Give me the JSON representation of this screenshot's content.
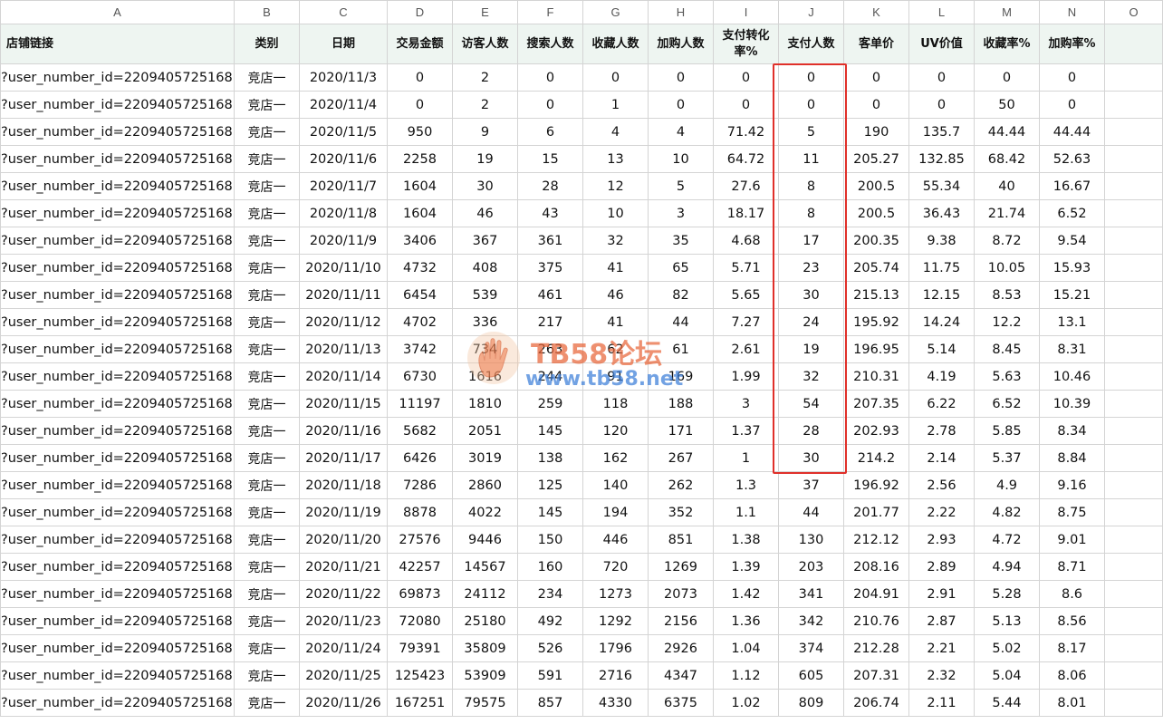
{
  "columns": [
    "A",
    "B",
    "C",
    "D",
    "E",
    "F",
    "G",
    "H",
    "I",
    "J",
    "K",
    "L",
    "M",
    "N",
    "O"
  ],
  "headers": [
    "店铺链接",
    "类别",
    "日期",
    "交易金额",
    "访客人数",
    "搜索人数",
    "收藏人数",
    "加购人数",
    "支付转化率%",
    "支付人数",
    "客单价",
    "UV价值",
    "收藏率%",
    "加购率%",
    ""
  ],
  "rows": [
    [
      "?user_number_id=2209405725168",
      "竞店一",
      "2020/11/3",
      "0",
      "2",
      "0",
      "0",
      "0",
      "0",
      "0",
      "0",
      "0",
      "0",
      "0"
    ],
    [
      "?user_number_id=2209405725168",
      "竞店一",
      "2020/11/4",
      "0",
      "2",
      "0",
      "1",
      "0",
      "0",
      "0",
      "0",
      "0",
      "50",
      "0"
    ],
    [
      "?user_number_id=2209405725168",
      "竞店一",
      "2020/11/5",
      "950",
      "9",
      "6",
      "4",
      "4",
      "71.42",
      "5",
      "190",
      "135.7",
      "44.44",
      "44.44"
    ],
    [
      "?user_number_id=2209405725168",
      "竞店一",
      "2020/11/6",
      "2258",
      "19",
      "15",
      "13",
      "10",
      "64.72",
      "11",
      "205.27",
      "132.85",
      "68.42",
      "52.63"
    ],
    [
      "?user_number_id=2209405725168",
      "竞店一",
      "2020/11/7",
      "1604",
      "30",
      "28",
      "12",
      "5",
      "27.6",
      "8",
      "200.5",
      "55.34",
      "40",
      "16.67"
    ],
    [
      "?user_number_id=2209405725168",
      "竞店一",
      "2020/11/8",
      "1604",
      "46",
      "43",
      "10",
      "3",
      "18.17",
      "8",
      "200.5",
      "36.43",
      "21.74",
      "6.52"
    ],
    [
      "?user_number_id=2209405725168",
      "竞店一",
      "2020/11/9",
      "3406",
      "367",
      "361",
      "32",
      "35",
      "4.68",
      "17",
      "200.35",
      "9.38",
      "8.72",
      "9.54"
    ],
    [
      "?user_number_id=2209405725168",
      "竞店一",
      "2020/11/10",
      "4732",
      "408",
      "375",
      "41",
      "65",
      "5.71",
      "23",
      "205.74",
      "11.75",
      "10.05",
      "15.93"
    ],
    [
      "?user_number_id=2209405725168",
      "竞店一",
      "2020/11/11",
      "6454",
      "539",
      "461",
      "46",
      "82",
      "5.65",
      "30",
      "215.13",
      "12.15",
      "8.53",
      "15.21"
    ],
    [
      "?user_number_id=2209405725168",
      "竞店一",
      "2020/11/12",
      "4702",
      "336",
      "217",
      "41",
      "44",
      "7.27",
      "24",
      "195.92",
      "14.24",
      "12.2",
      "13.1"
    ],
    [
      "?user_number_id=2209405725168",
      "竞店一",
      "2020/11/13",
      "3742",
      "734",
      "263",
      "62",
      "61",
      "2.61",
      "19",
      "196.95",
      "5.14",
      "8.45",
      "8.31"
    ],
    [
      "?user_number_id=2209405725168",
      "竞店一",
      "2020/11/14",
      "6730",
      "1616",
      "244",
      "91",
      "169",
      "1.99",
      "32",
      "210.31",
      "4.19",
      "5.63",
      "10.46"
    ],
    [
      "?user_number_id=2209405725168",
      "竞店一",
      "2020/11/15",
      "11197",
      "1810",
      "259",
      "118",
      "188",
      "3",
      "54",
      "207.35",
      "6.22",
      "6.52",
      "10.39"
    ],
    [
      "?user_number_id=2209405725168",
      "竞店一",
      "2020/11/16",
      "5682",
      "2051",
      "145",
      "120",
      "171",
      "1.37",
      "28",
      "202.93",
      "2.78",
      "5.85",
      "8.34"
    ],
    [
      "?user_number_id=2209405725168",
      "竞店一",
      "2020/11/17",
      "6426",
      "3019",
      "138",
      "162",
      "267",
      "1",
      "30",
      "214.2",
      "2.14",
      "5.37",
      "8.84"
    ],
    [
      "?user_number_id=2209405725168",
      "竞店一",
      "2020/11/18",
      "7286",
      "2860",
      "125",
      "140",
      "262",
      "1.3",
      "37",
      "196.92",
      "2.56",
      "4.9",
      "9.16"
    ],
    [
      "?user_number_id=2209405725168",
      "竞店一",
      "2020/11/19",
      "8878",
      "4022",
      "145",
      "194",
      "352",
      "1.1",
      "44",
      "201.77",
      "2.22",
      "4.82",
      "8.75"
    ],
    [
      "?user_number_id=2209405725168",
      "竞店一",
      "2020/11/20",
      "27576",
      "9446",
      "150",
      "446",
      "851",
      "1.38",
      "130",
      "212.12",
      "2.93",
      "4.72",
      "9.01"
    ],
    [
      "?user_number_id=2209405725168",
      "竞店一",
      "2020/11/21",
      "42257",
      "14567",
      "160",
      "720",
      "1269",
      "1.39",
      "203",
      "208.16",
      "2.89",
      "4.94",
      "8.71"
    ],
    [
      "?user_number_id=2209405725168",
      "竞店一",
      "2020/11/22",
      "69873",
      "24112",
      "234",
      "1273",
      "2073",
      "1.42",
      "341",
      "204.91",
      "2.91",
      "5.28",
      "8.6"
    ],
    [
      "?user_number_id=2209405725168",
      "竞店一",
      "2020/11/23",
      "72080",
      "25180",
      "492",
      "1292",
      "2156",
      "1.36",
      "342",
      "210.76",
      "2.87",
      "5.13",
      "8.56"
    ],
    [
      "?user_number_id=2209405725168",
      "竞店一",
      "2020/11/24",
      "79391",
      "35809",
      "526",
      "1796",
      "2926",
      "1.04",
      "374",
      "212.28",
      "2.21",
      "5.02",
      "8.17"
    ],
    [
      "?user_number_id=2209405725168",
      "竞店一",
      "2020/11/25",
      "125423",
      "53909",
      "591",
      "2716",
      "4347",
      "1.12",
      "605",
      "207.31",
      "2.32",
      "5.04",
      "8.06"
    ],
    [
      "?user_number_id=2209405725168",
      "竞店一",
      "2020/11/26",
      "167251",
      "79575",
      "857",
      "4330",
      "6375",
      "1.02",
      "809",
      "206.74",
      "2.11",
      "5.44",
      "8.01"
    ]
  ],
  "highlight": {
    "color": "#e0302a",
    "column": "J"
  },
  "watermark": {
    "line1": "TB58论坛",
    "line2": "www.tb58.net"
  }
}
